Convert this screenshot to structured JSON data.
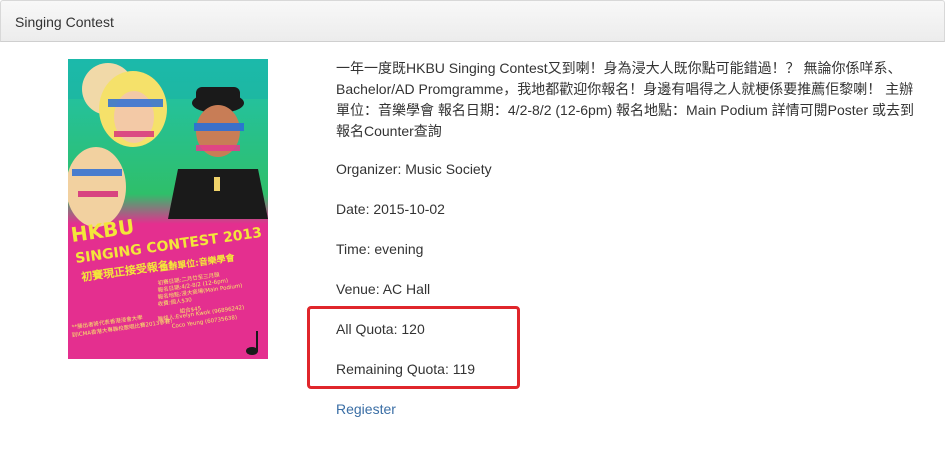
{
  "header": {
    "title": "Singing Contest"
  },
  "event": {
    "description": "一年一度既HKBU Singing Contest又到喇！身為浸大人既你點可能錯過！？ 無論你係咩系、Bachelor/AD Promgramme，我地都歡迎你報名！身邊有唱得之人就梗係要推薦佢黎喇！ 主辦單位：音樂學會 報名日期：4/2-8/2 (12-6pm) 報名地點：Main Podium 詳情可閱Poster 或去到報名Counter查詢",
    "organizer": "Organizer: Music Society",
    "date": "Date: 2015-10-02",
    "time": "Time: evening",
    "venue": "Venue: AC Hall",
    "all_quota": "All Quota: 120",
    "remaining_quota": "Remaining Quota: 119",
    "register_label": "Regiester"
  },
  "poster": {
    "title_lines": [
      "HKBU",
      "SINGING CONTEST 2013"
    ],
    "subtitle": "初賽現正接受報名!",
    "organizer_text": "主辦單位:音樂學會",
    "detail_lines": [
      "初賽日期:二月廿至三月頭",
      "報名日期:4/2-8/2 (12-6pm)",
      "報名地點:浸大商場(Main Podium)",
      "收費:個人$30",
      "組合$45",
      "聯絡人:Evelyn Kwok (96896242)",
      "Coco Yeung (60735638)"
    ],
    "footer_lines": [
      "**勝出者將代表香港浸會大學",
      "到ICMA香港大專聯校歌唱比賽2013參賽!"
    ],
    "colors": {
      "background": "#e42f8f",
      "accent_green": "#2fbf6a",
      "accent_yellow": "#f3e63a",
      "accent_blue": "#3aa0e8"
    }
  },
  "colors": {
    "highlight_border": "#e0262b",
    "link": "#3a6ea5"
  }
}
